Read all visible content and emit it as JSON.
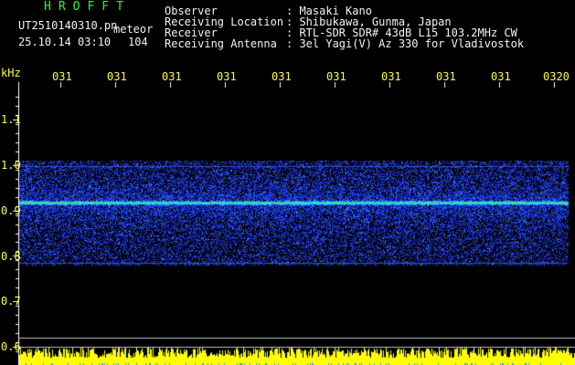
{
  "header": {
    "logo": "HROFFT",
    "file_name": "UT2510140310.pn",
    "mode": "meteor",
    "date_time": "25.10.14 03:10",
    "count": "104",
    "fields": [
      {
        "label": "Observer",
        "value": ": Masaki Kano"
      },
      {
        "label": "Receiving Location",
        "value": ": Shibukawa, Gunma, Japan"
      },
      {
        "label": "Receiver",
        "value": ": RTL-SDR SDR# 43dB L15 103.2MHz CW"
      },
      {
        "label": "Receiving Antenna",
        "value": ": 3el Yagi(V) Az 330 for Vladivostok"
      }
    ]
  },
  "axis": {
    "y_unit": "kHz",
    "y_ticks": [
      "1.1",
      "1.0",
      "0.9",
      "0.8",
      "0.7",
      "0.6"
    ],
    "x_ticks": [
      "031",
      "031",
      "031",
      "031",
      "031",
      "031",
      "031",
      "031",
      "031",
      "0320"
    ]
  },
  "colors": {
    "background": "#000000",
    "text": "#f2f2f2",
    "logo": "#20ff20",
    "axis_labels": "#ffff33",
    "noise_low": "#1a2bd8",
    "noise_mid": "#2f7dff",
    "signal_line": "#40ff60"
  },
  "spectrogram": {
    "band_khz": [
      0.78,
      1.0
    ],
    "carrier_khz": 0.918,
    "lower_edge_khz": 0.785,
    "upper_edge_khz": 0.998
  }
}
